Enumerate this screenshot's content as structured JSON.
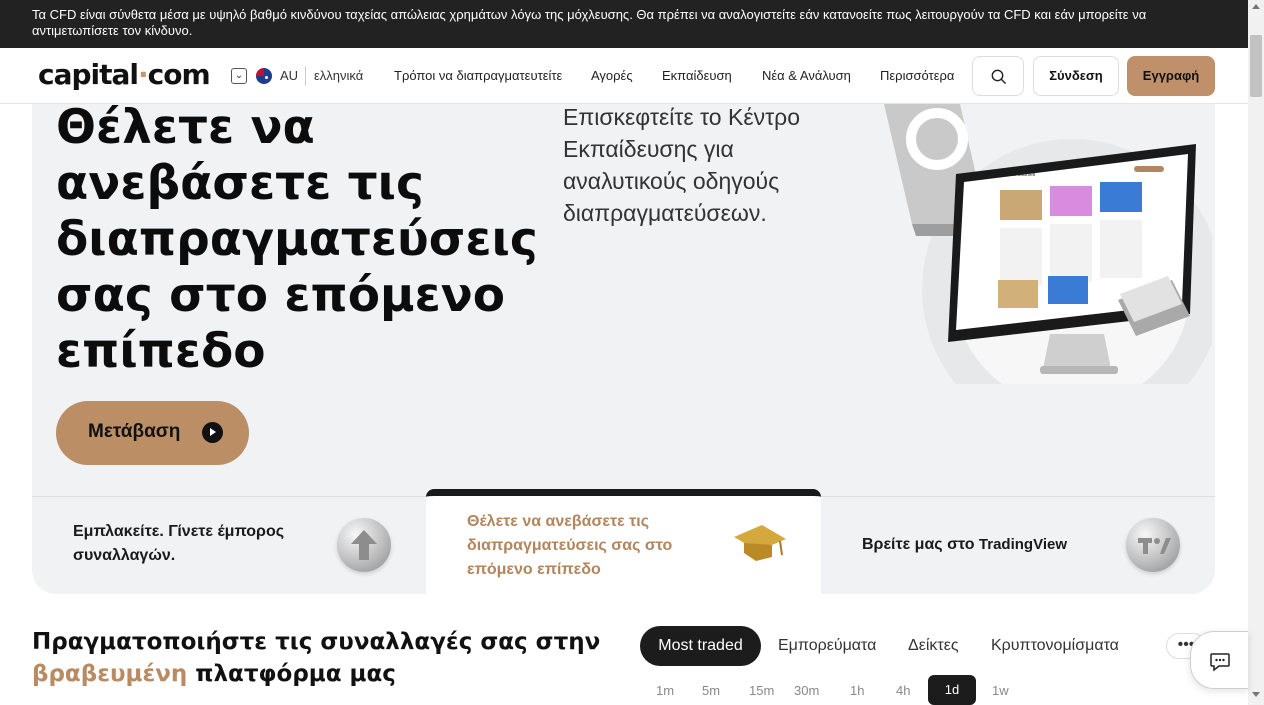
{
  "risk_warning": "Τα CFD είναι σύνθετα μέσα με υψηλό βαθμό κινδύνου ταχείας απώλειας χρημάτων λόγω της μόχλευσης. Θα πρέπει να αναλογιστείτε εάν κατανοείτε πως λειτουργούν τα CFD και εάν μπορείτε να αντιμετωπίσετε τον κίνδυνο.",
  "header": {
    "logo_main": "capital",
    "logo_dot": "·",
    "logo_tld": "com",
    "chevron": "⌄",
    "region": "AU",
    "language": "ελληνικά",
    "nav": [
      "Τρόποι να διαπραγματευτείτε",
      "Αγορές",
      "Εκπαίδευση",
      "Νέα & Ανάλυση",
      "Περισσότερα"
    ],
    "login": "Σύνδεση",
    "signup": "Εγγραφή"
  },
  "hero": {
    "title": "Θέλετε να ανεβάσετε τις διαπραγματεύσεις σας στο επόμενο επίπεδο",
    "subtitle": "Επισκεφτείτε το Κέντρο Εκπαίδευσης για αναλυτικούς οδηγούς διαπραγματεύσεων.",
    "cta": "Μετάβαση",
    "illustration_text": "Our courses"
  },
  "hero_tabs": [
    {
      "label": "Εμπλακείτε. Γίνετε έμπορος συναλλαγών.",
      "icon": "arrow-up-icon"
    },
    {
      "label": "Θέλετε να ανεβάσετε τις διαπραγματεύσεις σας στο επόμενο επίπεδο",
      "icon": "graduation-cap-icon",
      "active": true
    },
    {
      "label_prefix": "Βρείτε μας στο ",
      "label_suffix": "TradingView",
      "icon": "tradingview-icon"
    }
  ],
  "platform": {
    "title_line1": "Πραγματοποιήστε τις συναλλαγές σας στην",
    "title_accent": "βραβευμένη",
    "title_rest": " πλατφόρμα μας"
  },
  "market_filters": [
    "Most traded",
    "Εμπορεύματα",
    "Δείκτες",
    "Κρυπτονομίσματα"
  ],
  "more_label": "•••",
  "timeframes": [
    "1m",
    "5m",
    "15m",
    "30m",
    "1h",
    "4h",
    "1d",
    "1w"
  ],
  "colors": {
    "accent": "#c0906a",
    "dark": "#1c1c1c",
    "hero_bg": "#f1f2f4"
  }
}
